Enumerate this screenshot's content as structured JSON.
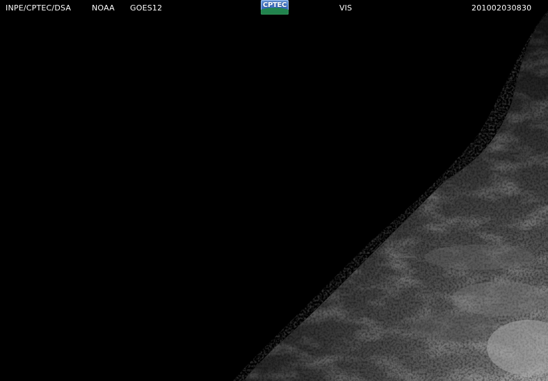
{
  "header": {
    "agency": "INPE/CPTEC/DSA",
    "noaa": "NOAA",
    "satellite": "GOES12",
    "channel": "VIS",
    "timestamp": "201002030830"
  },
  "logo": {
    "text": "CPTEC",
    "icon": "cptec-logo-icon"
  },
  "colors": {
    "background": "#000000",
    "text": "#ffffff",
    "logo_blue": "#3a6cc0",
    "logo_green": "#1f8a3c",
    "earth_gray": "#5a5a5a"
  }
}
